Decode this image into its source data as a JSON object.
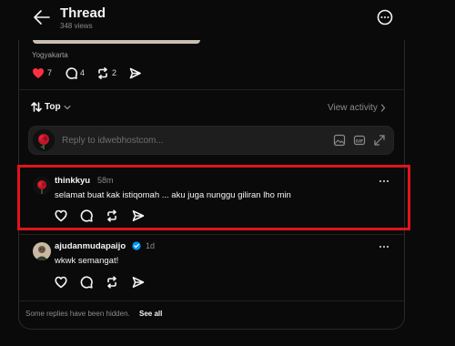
{
  "header": {
    "title": "Thread",
    "views": "348 views"
  },
  "post": {
    "location": "Yogyakarta",
    "likes": "7",
    "replies": "4",
    "reposts": "2"
  },
  "sort": {
    "label": "Top",
    "view_activity": "View activity"
  },
  "reply_box": {
    "placeholder": "Reply to idwebhostcom..."
  },
  "comments": [
    {
      "username": "thinkkyu",
      "time": "58m",
      "text": "selamat buat kak istiqomah ... aku juga nunggu giliran lho min",
      "verified": false
    },
    {
      "username": "ajudanmudapaijo",
      "time": "1d",
      "text": "wkwk semangat!",
      "verified": true
    }
  ],
  "footer": {
    "hidden_note": "Some replies have been hidden.",
    "see_all": "See all"
  },
  "colors": {
    "background": "#0a0a0a",
    "like_red": "#ff3040",
    "verified_blue": "#0095f6",
    "highlight_red": "#e0141b"
  }
}
